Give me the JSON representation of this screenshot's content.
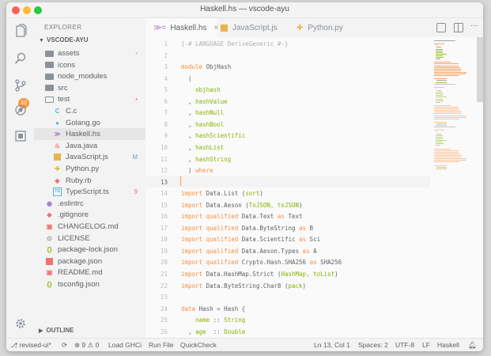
{
  "window": {
    "title": "Haskell.hs — vscode-ayu"
  },
  "activity": {
    "badge": "10"
  },
  "sidebar": {
    "header": "EXPLORER",
    "root": "VSCODE-AYU",
    "items": [
      {
        "label": "assets",
        "icon": "folder-icon",
        "depth": 0,
        "status": "•",
        "status_color": "#b8bcc0"
      },
      {
        "label": "icons",
        "icon": "folder-icon",
        "depth": 0,
        "status": "",
        "status_color": ""
      },
      {
        "label": "node_modules",
        "icon": "folder-icon",
        "depth": 0,
        "status": "",
        "status_color": ""
      },
      {
        "label": "src",
        "icon": "folder-icon",
        "depth": 0,
        "status": "",
        "status_color": ""
      },
      {
        "label": "test",
        "icon": "folder-open-icon",
        "depth": 0,
        "status": "•",
        "status_color": "#f07171"
      },
      {
        "label": "C.c",
        "icon": "c-file-icon",
        "depth": 1,
        "status": "",
        "status_color": ""
      },
      {
        "label": "Golang.go",
        "icon": "go-file-icon",
        "depth": 1,
        "status": "",
        "status_color": ""
      },
      {
        "label": "Haskell.hs",
        "icon": "haskell-file-icon",
        "depth": 1,
        "status": "",
        "status_color": ""
      },
      {
        "label": "Java.java",
        "icon": "java-file-icon",
        "depth": 1,
        "status": "",
        "status_color": ""
      },
      {
        "label": "JavaScript.js",
        "icon": "js-file-icon",
        "depth": 1,
        "status": "M",
        "status_color": "#7a9cc6"
      },
      {
        "label": "Python.py",
        "icon": "python-file-icon",
        "depth": 1,
        "status": "",
        "status_color": ""
      },
      {
        "label": "Ruby.rb",
        "icon": "ruby-file-icon",
        "depth": 1,
        "status": "",
        "status_color": ""
      },
      {
        "label": "TypeScript.ts",
        "icon": "ts-file-icon",
        "depth": 1,
        "status": "9",
        "status_color": "#f07171"
      },
      {
        "label": ".eslintrc",
        "icon": "eslint-icon",
        "depth": 0,
        "status": "",
        "status_color": ""
      },
      {
        "label": ".gitignore",
        "icon": "git-icon",
        "depth": 0,
        "status": "",
        "status_color": ""
      },
      {
        "label": "CHANGELOG.md",
        "icon": "markdown-icon",
        "depth": 0,
        "status": "",
        "status_color": ""
      },
      {
        "label": "LICENSE",
        "icon": "license-icon",
        "depth": 0,
        "status": "",
        "status_color": ""
      },
      {
        "label": "package-lock.json",
        "icon": "json-icon",
        "depth": 0,
        "status": "",
        "status_color": ""
      },
      {
        "label": "package.json",
        "icon": "npm-icon",
        "depth": 0,
        "status": "",
        "status_color": ""
      },
      {
        "label": "README.md",
        "icon": "markdown-icon",
        "depth": 0,
        "status": "",
        "status_color": ""
      },
      {
        "label": "tsconfig.json",
        "icon": "json-icon",
        "depth": 0,
        "status": "",
        "status_color": ""
      }
    ],
    "outline": "OUTLINE"
  },
  "tabs": [
    {
      "label": "Haskell.hs",
      "icon": "haskell-file-icon",
      "active": true
    },
    {
      "label": "JavaScript.js",
      "icon": "js-file-icon",
      "active": false
    },
    {
      "label": "Python.py",
      "icon": "python-file-icon",
      "active": false
    }
  ],
  "editor": {
    "lines": [
      {
        "n": "1",
        "code": "{-# LANGUAGE DeriveGeneric #-}"
      },
      {
        "n": "2",
        "code": ""
      },
      {
        "n": "3",
        "code": "module ObjHash"
      },
      {
        "n": "4",
        "code": "  ("
      },
      {
        "n": "5",
        "code": "    objhash"
      },
      {
        "n": "6",
        "code": "  , hashValue"
      },
      {
        "n": "7",
        "code": "  , hashNull"
      },
      {
        "n": "8",
        "code": "  , hashBool"
      },
      {
        "n": "9",
        "code": "  , hashScientific"
      },
      {
        "n": "10",
        "code": "  , hashList"
      },
      {
        "n": "11",
        "code": "  , hashString"
      },
      {
        "n": "12",
        "code": "  ) where"
      },
      {
        "n": "13",
        "code": ""
      },
      {
        "n": "14",
        "code": "import Data.List (sort)"
      },
      {
        "n": "15",
        "code": "import Data.Aeson (ToJSON, toJSON)"
      },
      {
        "n": "16",
        "code": "import qualified Data.Text as Text"
      },
      {
        "n": "17",
        "code": "import qualified Data.ByteString as B"
      },
      {
        "n": "18",
        "code": "import qualified Data.Scientific as Sci"
      },
      {
        "n": "19",
        "code": "import qualified Data.Aeson.Types as A"
      },
      {
        "n": "20",
        "code": "import qualified Crypto.Hash.SHA256 as SHA256"
      },
      {
        "n": "21",
        "code": "import Data.HashMap.Strict (HashMap, toList)"
      },
      {
        "n": "22",
        "code": "import Data.ByteString.Char8 (pack)"
      },
      {
        "n": "23",
        "code": ""
      },
      {
        "n": "24",
        "code": "data Hash = Hash {"
      },
      {
        "n": "25",
        "code": "    name :: String"
      },
      {
        "n": "26",
        "code": "  , age  :: Double"
      }
    ]
  },
  "statusbar": {
    "branch": "revised-ui*",
    "sync": "",
    "errors": "9",
    "warnings": "0",
    "load_ghci": "Load GHCi",
    "run_file": "Run File",
    "quickcheck": "QuickCheck",
    "position": "Ln 13, Col 1",
    "spaces": "Spaces: 2",
    "encoding": "UTF-8",
    "eol": "LF",
    "language": "Haskell"
  },
  "colors": {
    "accent": "#ff9940",
    "keyword": "#fa8d3e",
    "string": "#86b300"
  }
}
